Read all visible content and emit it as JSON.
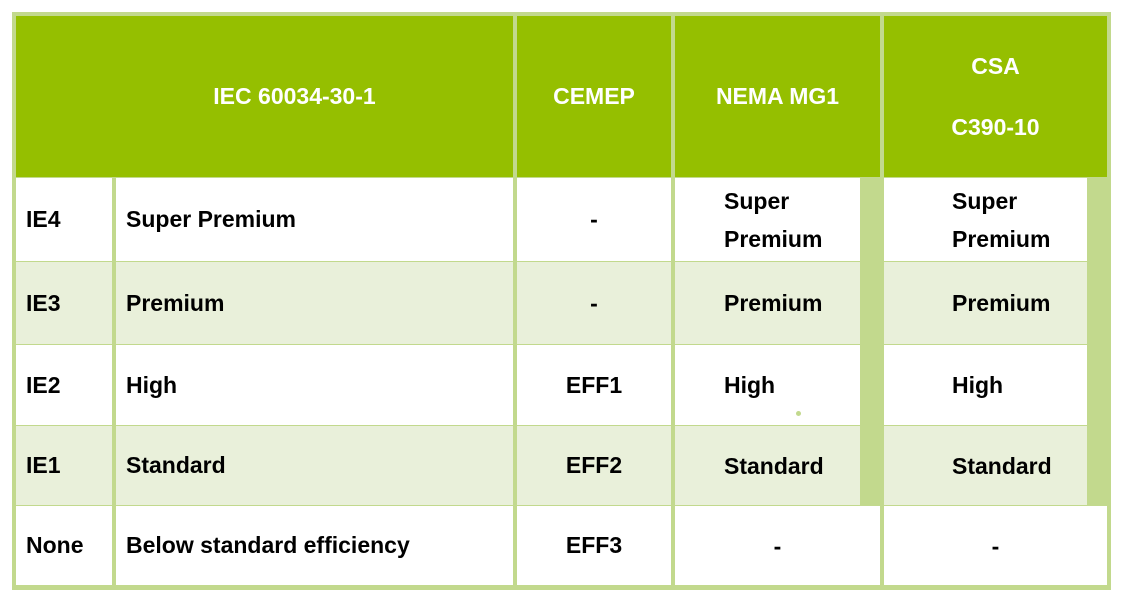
{
  "header": {
    "iec": "IEC 60034-30-1",
    "cemep": "CEMEP",
    "nema": "NEMA MG1",
    "csa_line1": "CSA",
    "csa_line2": "C390-10"
  },
  "rows": [
    {
      "class": "IE4",
      "iec_name": "Super Premium",
      "cemep": "-",
      "nema": "Super Premium",
      "csa": "Super Premium"
    },
    {
      "class": "IE3",
      "iec_name": "Premium",
      "cemep": "-",
      "nema": "Premium",
      "csa": "Premium"
    },
    {
      "class": "IE2",
      "iec_name": "High",
      "cemep": "EFF1",
      "nema": "High",
      "csa": "High"
    },
    {
      "class": "IE1",
      "iec_name": "Standard",
      "cemep": "EFF2",
      "nema": "Standard",
      "csa": "Standard"
    },
    {
      "class": "None",
      "iec_name": "Below standard efficiency",
      "cemep": "EFF3",
      "nema": "-",
      "csa": "-"
    }
  ],
  "colors": {
    "header_bg": "#95bf00",
    "border": "#c2d98d",
    "alt_row": "#e9f0da"
  }
}
